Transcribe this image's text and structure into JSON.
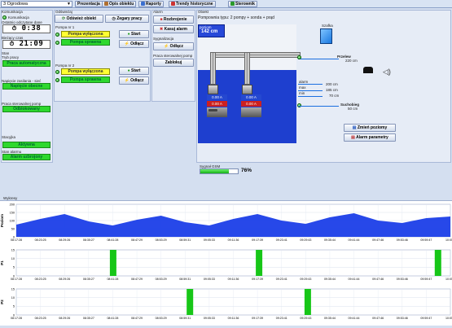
{
  "toolbar": {
    "select": "3 Ogrodowa",
    "buttons": [
      "Prezentacja",
      "Opis obiektu",
      "Raporty",
      "Trendy historyczne",
      "Sterownik"
    ]
  },
  "left": {
    "komunikacja_title": "Komunikacja",
    "komunikacja_label": "Komunikacja",
    "ostatnie_label": "Ostatnio odczytane dane",
    "time1": "0:38",
    "biezacy_label": "Bieżący czas",
    "time2": "21:09",
    "stan_title": "Stan",
    "tryb_label": "Tryb pracy",
    "tryb_value": "Praca automatyczna",
    "napiecie_label": "Napięcie zasilania - sieć",
    "napiecie_value": "Napięcie obecne",
    "praca_label": "Praca sterowalnej pomp",
    "praca_value": "Odblokowany",
    "stacyjka_label": "Stacyjka",
    "stacyjka_value": "Aktywna",
    "stan_alarmu_label": "Stan alarmu",
    "stan_alarmu_value": "Alarm uzbrojony"
  },
  "middle": {
    "odswiez_title": "Odświeżaj",
    "odswiez_button": "Odśwież obiekt",
    "zegary_button": "Zegary pracy",
    "p1_title": "Pompa nr 1",
    "p1_status1": "Pompa wyłączona",
    "p1_status2": "Pompa sprawna",
    "p2_title": "Pompa nr 2",
    "p2_status1": "Pompa wyłączona",
    "p2_status2": "Pompa sprawna",
    "start": "Start",
    "odlacz": "Odłącz"
  },
  "alarm": {
    "title": "Alarm",
    "rozbrojenie": "Rozbrojenie",
    "kasuj": "Kasuj alarm",
    "sygnalizacja_title": "Sygnalizacja",
    "odlacz": "Odłącz",
    "praca_title": "Praca sterowalnej pomp",
    "zablokuj": "Zablokuj"
  },
  "obiekt": {
    "title": "Obiekt",
    "subtitle": "Pompownia typu: 2 pompy + sonda + prąd",
    "poziom_label": "poziom",
    "poziom_value": "142 cm",
    "szafka": "Szafka",
    "current1a": "0.00 A",
    "current1b": "0.00 A",
    "current2a": "0.00 A",
    "current2b": "0.00 A",
    "przelew": "Przelew",
    "przelew_value": "220 cm",
    "alarm": "alarm",
    "max": "max",
    "alarm_value": "200 cm",
    "max_value": "185 cm",
    "min": "min",
    "min_value": "70 cm",
    "suchobieg": "Suchobieg",
    "suchobieg_value": "50 cm",
    "gsm_label": "Sygnał GSM",
    "gsm_value": "76%",
    "gsm_fraction": 0.76,
    "zmien_button": "Zmień poziomy",
    "alarm_param_button": "Alarm parametry"
  },
  "wykresy": {
    "title": "Wykresy",
    "poziom_axis": "Poziom",
    "p1_axis": "P1",
    "p2_axis": "P2",
    "y_ticks_level": [
      "200",
      "150",
      "100",
      "50",
      "0"
    ],
    "y_ticks_p": [
      "15",
      "10",
      "5",
      "0"
    ],
    "times": [
      "08:17:28",
      "08:23:25",
      "08:29:26",
      "08:35:27",
      "08:41:28",
      "08:47:29",
      "08:53:29",
      "08:59:31",
      "09:05:33",
      "09:11:36",
      "09:17:39",
      "09:23:41",
      "09:29:43",
      "09:35:44",
      "09:41:44",
      "09:47:46",
      "09:53:46",
      "09:59:47",
      "10:05:4"
    ]
  },
  "chart_data": [
    {
      "type": "area",
      "title": "",
      "ylabel": "Poziom",
      "ylim": [
        0,
        200
      ],
      "x": [
        "08:17:28",
        "08:23:25",
        "08:29:26",
        "08:35:27",
        "08:41:28",
        "08:47:29",
        "08:53:29",
        "08:59:31",
        "09:05:33",
        "09:11:36",
        "09:17:39",
        "09:23:41",
        "09:29:43",
        "09:35:44",
        "09:41:44",
        "09:47:46",
        "09:53:46",
        "09:59:47",
        "10:05:4"
      ],
      "series": [
        {
          "values": [
            75,
            110,
            140,
            95,
            70,
            105,
            130,
            90,
            70,
            110,
            140,
            100,
            80,
            120,
            145,
            100,
            85,
            115,
            125
          ]
        }
      ],
      "color": "#1b3ee8"
    },
    {
      "type": "bar",
      "title": "",
      "ylabel": "P1",
      "ylim": [
        0,
        15
      ],
      "pulses_x": [
        "08:41:28",
        "09:17:39",
        "10:02:00"
      ],
      "value": 15,
      "color": "#17c617"
    },
    {
      "type": "bar",
      "title": "",
      "ylabel": "P2",
      "ylim": [
        0,
        15
      ],
      "pulses_x": [
        "09:00:30",
        "09:29:43"
      ],
      "value": 15,
      "color": "#17c617"
    }
  ]
}
